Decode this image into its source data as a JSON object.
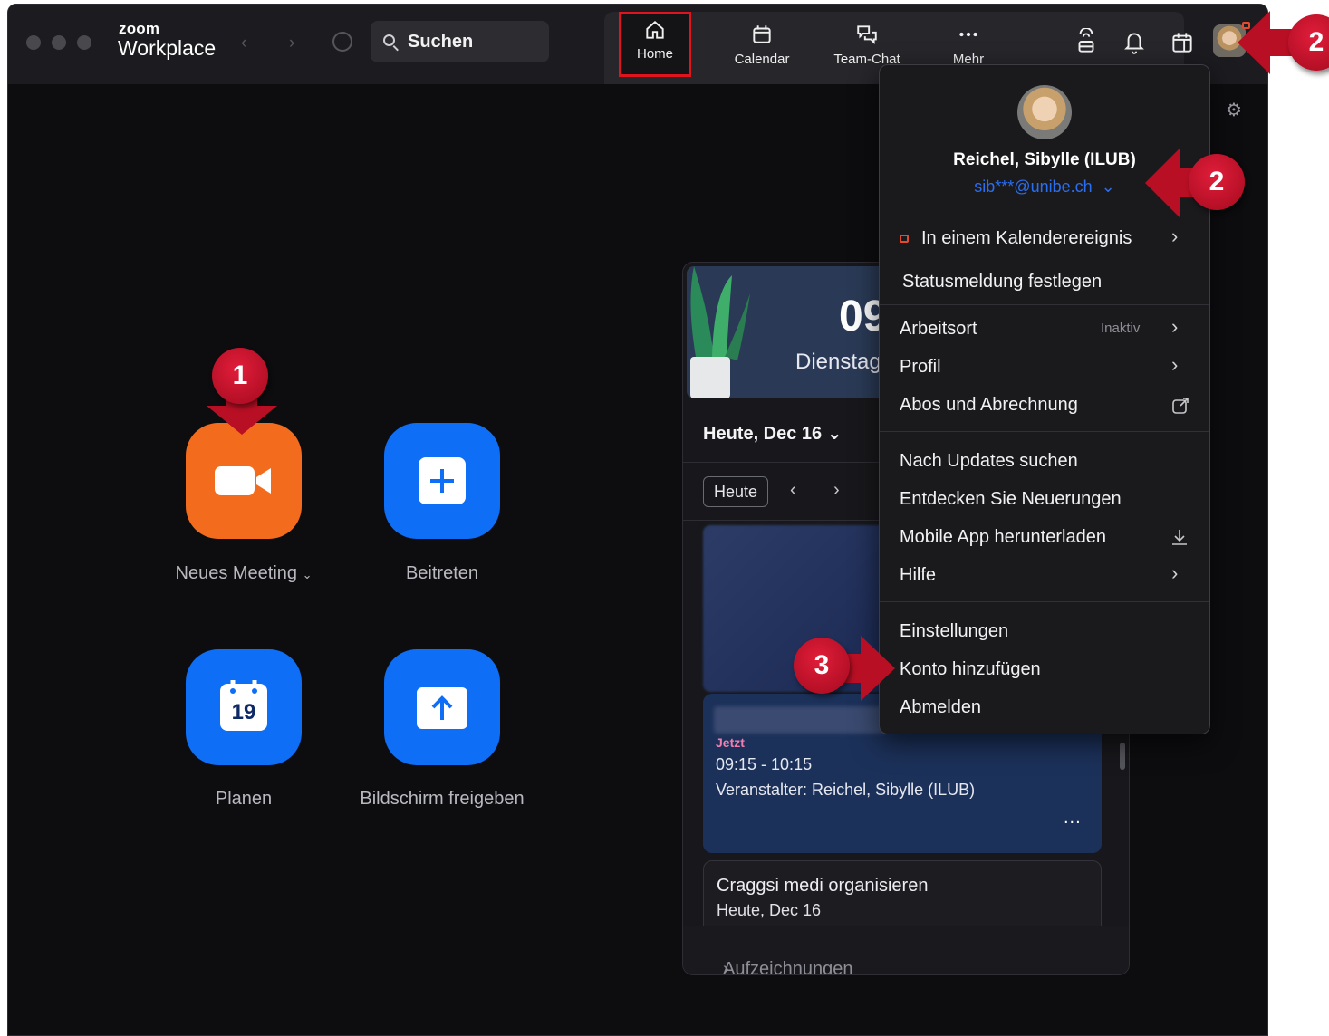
{
  "app": {
    "brand_small": "zoom",
    "brand_big": "Workplace"
  },
  "search": {
    "label": "Suchen"
  },
  "tabs": [
    {
      "label": "Home"
    },
    {
      "label": "Calendar"
    },
    {
      "label": "Team-Chat"
    },
    {
      "label": "Mehr"
    }
  ],
  "actions": {
    "new_meeting": "Neues Meeting",
    "join": "Beitreten",
    "schedule": "Planen",
    "schedule_day": "19",
    "share": "Bildschirm freigeben"
  },
  "calendar": {
    "hero_time": "09",
    "hero_day": "Dienstag",
    "today_label": "Heute, Dec 16",
    "today_button": "Heute",
    "meeting1": {
      "now": "Jetzt",
      "time": "09:15 - 10:15",
      "host": "Veranstalter: Reichel, Sibylle (ILUB)",
      "more": "..."
    },
    "meeting2": {
      "title": "Craggsi medi organisieren",
      "date": "Heute, Dec 16"
    },
    "footer": "Aufzeichnungen öffnen"
  },
  "profile_menu": {
    "name": "Reichel, Sibylle (ILUB)",
    "email": "sib***@unibe.ch",
    "items": [
      {
        "label": "In einem Kalenderereignis"
      },
      {
        "label": "Statusmeldung festlegen"
      },
      {
        "label": "Arbeitsort",
        "meta": "Inaktiv"
      },
      {
        "label": "Profil"
      },
      {
        "label": "Abos und Abrechnung"
      },
      {
        "label": "Nach Updates suchen"
      },
      {
        "label": "Entdecken Sie Neuerungen"
      },
      {
        "label": "Mobile App herunterladen"
      },
      {
        "label": "Hilfe"
      },
      {
        "label": "Einstellungen"
      },
      {
        "label": "Konto hinzufügen"
      },
      {
        "label": "Abmelden"
      }
    ]
  },
  "callouts": {
    "one": "1",
    "two": "2",
    "three": "3"
  },
  "colors": {
    "accent_red": "#c8102e",
    "zoom_blue": "#0e6ef5",
    "zoom_orange": "#f36c1d",
    "highlight": "#e0141e"
  }
}
